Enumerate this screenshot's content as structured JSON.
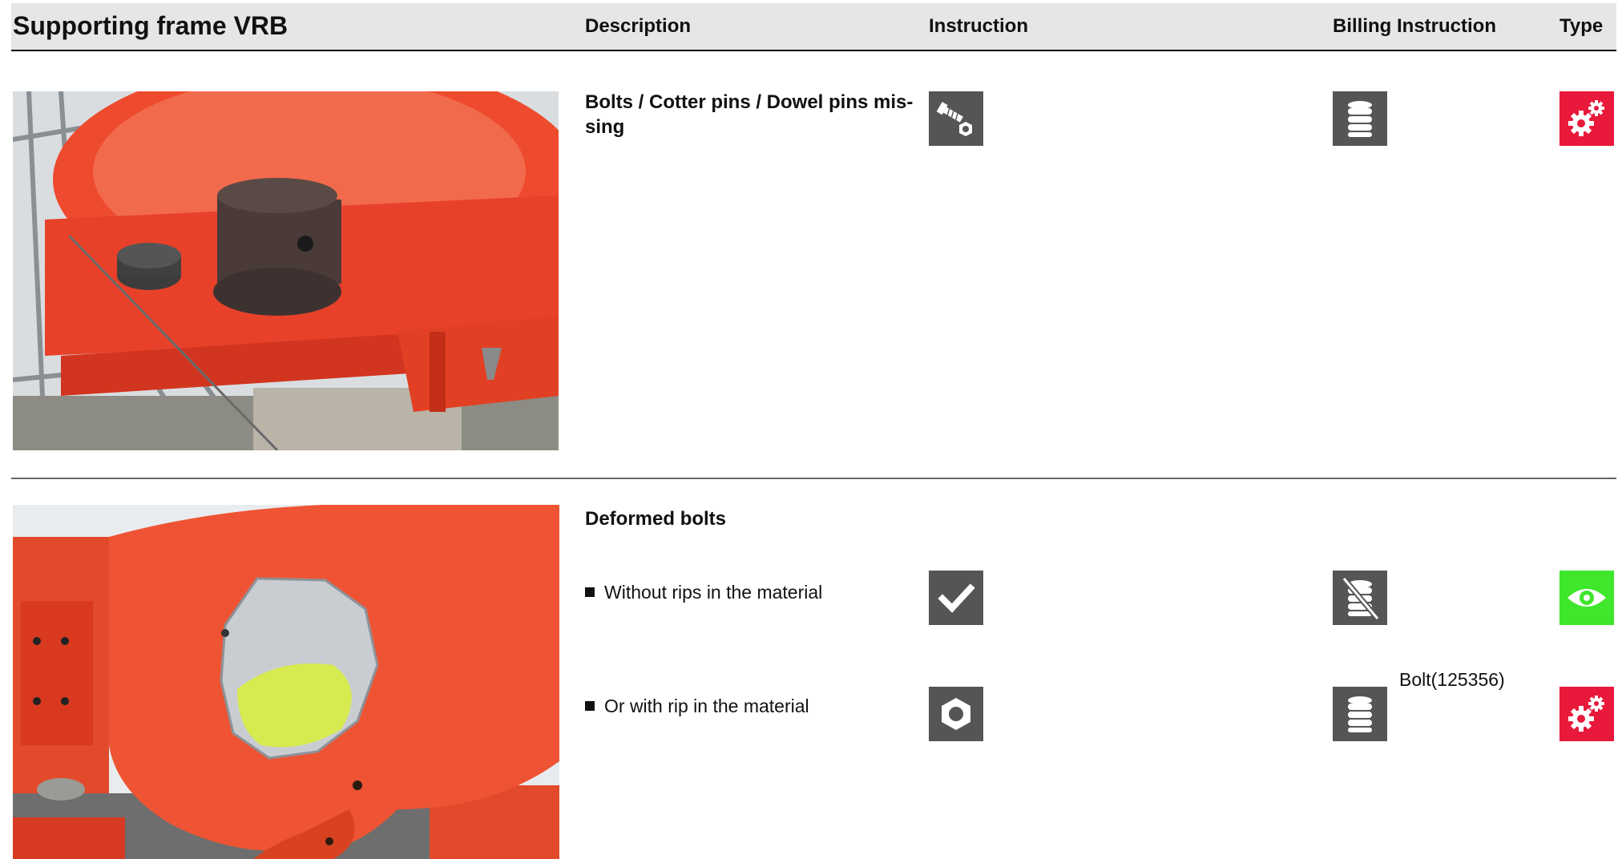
{
  "header": {
    "title": "Supporting frame VRB",
    "columns": {
      "description": "Description",
      "instruction": "Instruction",
      "billing": "Billing Instruction",
      "type": "Type"
    }
  },
  "items": [
    {
      "title": "Bolts / Cotter pins / Dowel pins mis-sing",
      "instruction_icon": "bolt-and-nut-icon",
      "billing_icon": "coin-stack-icon",
      "type_icon": "gears-icon",
      "type_color": "#e8193a"
    },
    {
      "title": "Deformed bolts",
      "options": [
        {
          "text": "Without rips in the material",
          "instruction_icon": "checkmark-icon",
          "billing_icon": "no-charge-coin-icon",
          "type_icon": "eye-icon",
          "type_color": "#3ee62c"
        },
        {
          "text": "Or with rip in the material",
          "instruction_icon": "nut-icon",
          "billing_icon": "coin-stack-icon",
          "billing_note": "Bolt(125356)",
          "type_icon": "gears-icon",
          "type_color": "#e8193a"
        }
      ]
    }
  ],
  "colors": {
    "icon_gray": "#555555",
    "header_bg": "#e6e6e6"
  }
}
